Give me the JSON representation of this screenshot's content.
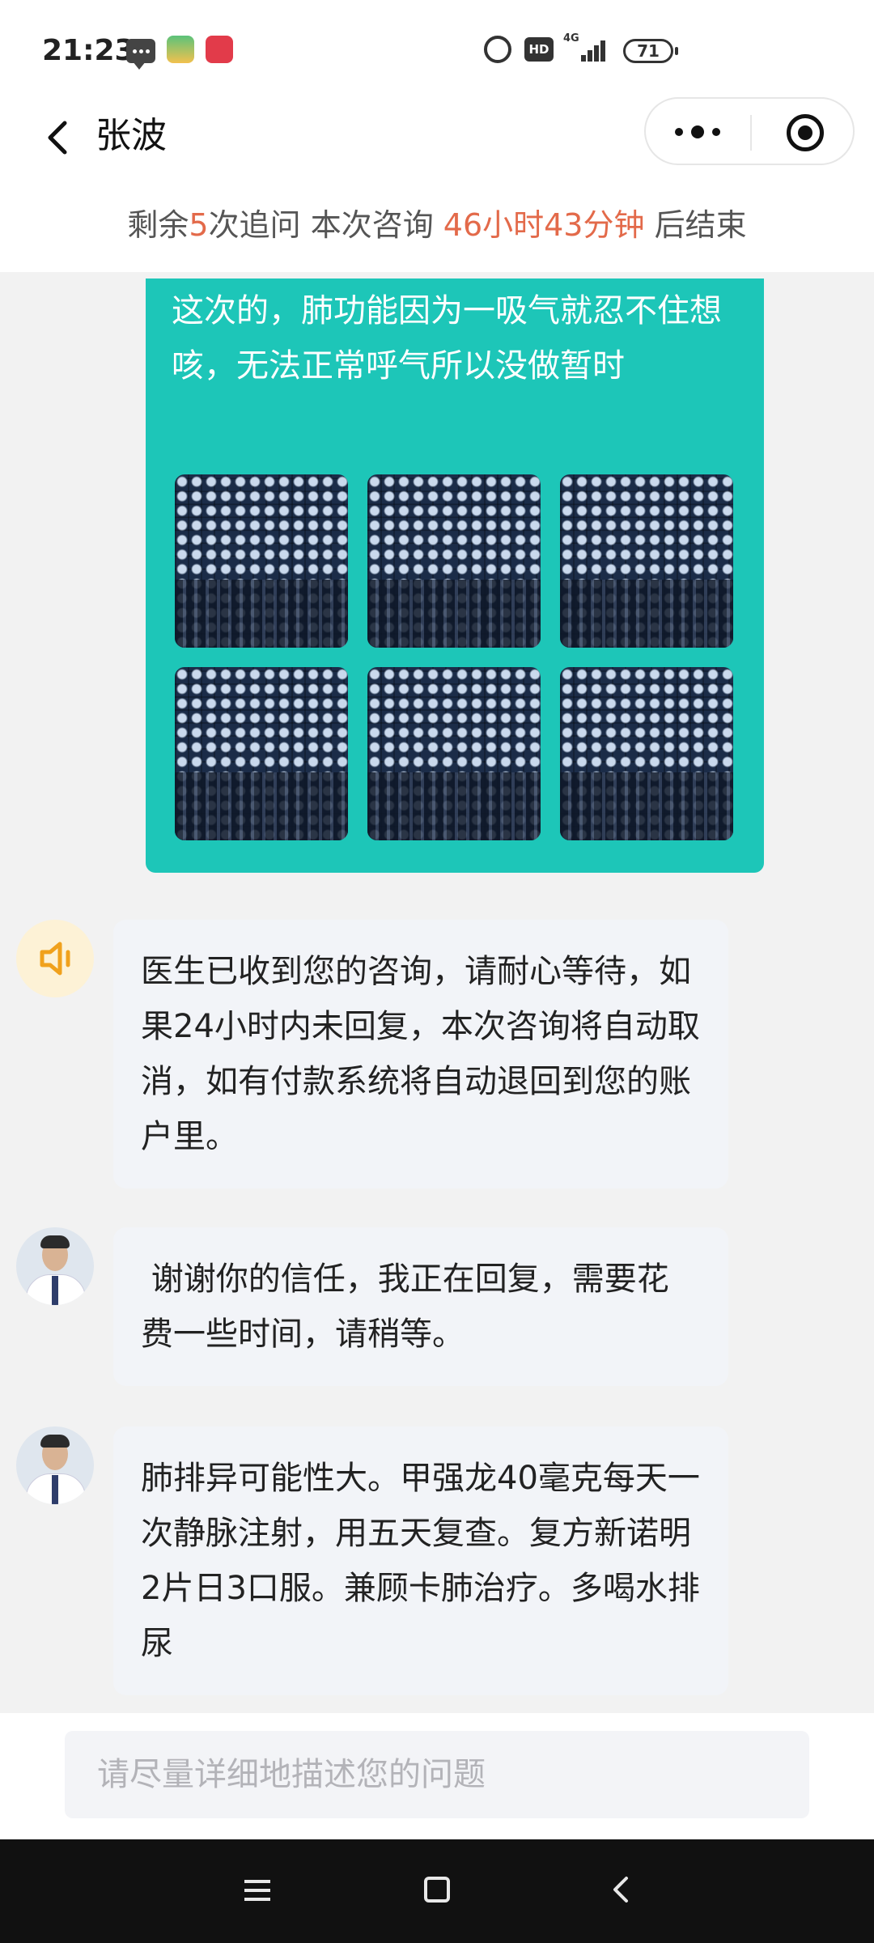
{
  "status_bar": {
    "time": "21:23",
    "network": "4G",
    "hd": "HD",
    "battery": "71"
  },
  "header": {
    "title": "张波"
  },
  "consult_info": {
    "prefix": "剩余",
    "remaining_count": "5",
    "middle": "次追问 本次咨询 ",
    "time_left": "46小时43分钟",
    "suffix": " 后结束"
  },
  "messages": {
    "user_message": {
      "text": "这次的，肺功能因为一吸气就忍不住想咳，无法正常呼气所以没做暂时",
      "image_count": 6
    },
    "system_notice": {
      "text": "医生已收到您的咨询，请耐心等待，如果24小时内未回复，本次咨询将自动取消，如有付款系统将自动退回到您的账户里。"
    },
    "doctor_reply_1": {
      "text": " 谢谢你的信任，我正在回复，需要花费一些时间，请稍等。"
    },
    "doctor_reply_2": {
      "text": "肺排异可能性大。甲强龙40毫克每天一次静脉注射，用五天复查。复方新诺明2片日3口服。兼顾卡肺治疗。多喝水排尿"
    }
  },
  "input": {
    "placeholder": "请尽量详细地描述您的问题"
  },
  "colors": {
    "user_bubble": "#1dc6b8",
    "highlight": "#e36a4a",
    "doctor_bubble": "#f2f4f8"
  }
}
